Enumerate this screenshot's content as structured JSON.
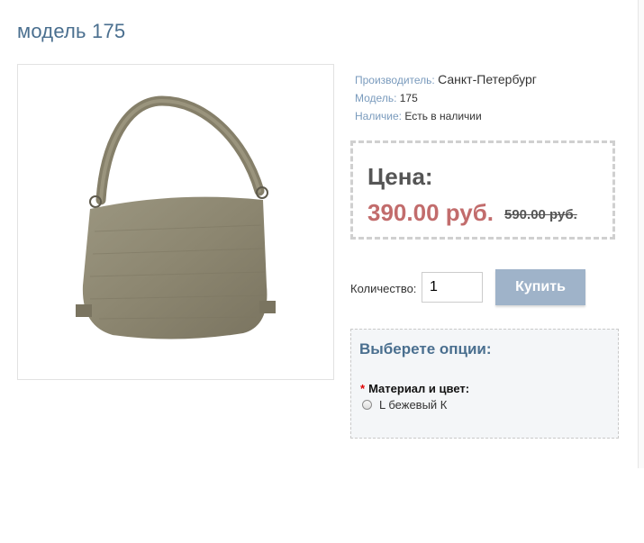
{
  "product": {
    "title": "модель 175",
    "image_icon": "handbag-photo"
  },
  "info": {
    "manufacturer_label": "Производитель:",
    "manufacturer_value": "Санкт-Петербург",
    "model_label": "Модель:",
    "model_value": "175",
    "availability_label": "Наличие:",
    "availability_value": "Есть в наличии"
  },
  "price": {
    "label": "Цена:",
    "new_price": "390.00 руб.",
    "old_price": "590.00 руб."
  },
  "purchase": {
    "quantity_label": "Количество:",
    "quantity_value": "1",
    "buy_label": "Купить"
  },
  "options": {
    "title": "Выберете опции:",
    "required_mark": "*",
    "material_label": "Материал и цвет:",
    "choices": [
      {
        "label": "L бежевый К",
        "selected": false
      }
    ]
  },
  "colors": {
    "accent": "#4a6f8f",
    "price_new": "#c26c6c",
    "button": "#9fb3c9"
  }
}
